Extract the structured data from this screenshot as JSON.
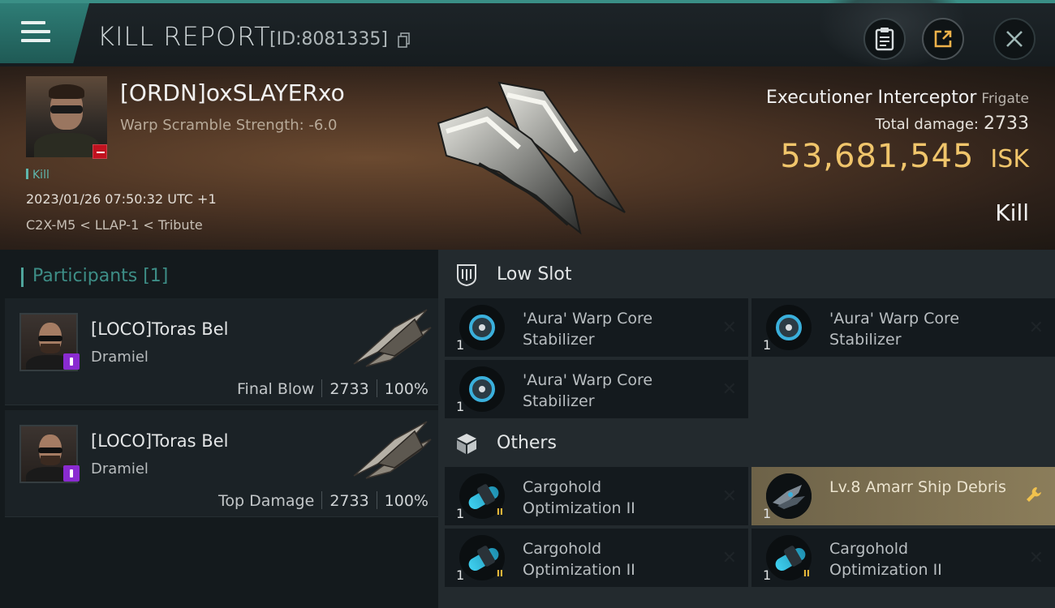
{
  "header": {
    "title": "KILL REPORT",
    "report_id": "[ID:8081335]"
  },
  "victim": {
    "name": "[ORDN]oxSLAYERxo",
    "warp_scramble": "Warp Scramble Strength: -6.0",
    "tag": "Kill",
    "datetime": "2023/01/26 07:50:32 UTC +1",
    "location": "C2X-M5 < LLAP-1 < Tribute",
    "ship_name": "Executioner Interceptor",
    "ship_class": "Frigate",
    "total_damage_label": "Total damage:",
    "total_damage": "2733",
    "isk_value": "53,681,545",
    "isk_unit": "ISK",
    "result": "Kill"
  },
  "participants": {
    "header": "Participants [1]",
    "items": [
      {
        "name": "[LOCO]Toras Bel",
        "ship": "Dramiel",
        "role": "Final Blow",
        "damage": "2733",
        "percent": "100%"
      },
      {
        "name": "[LOCO]Toras Bel",
        "ship": "Dramiel",
        "role": "Top Damage",
        "damage": "2733",
        "percent": "100%"
      }
    ]
  },
  "low_slot": {
    "header": "Low Slot",
    "items": [
      {
        "qty": "1",
        "name": "'Aura' Warp Core Stabilizer",
        "icon": "warp-core-stabilizer-icon"
      },
      {
        "qty": "1",
        "name": "'Aura' Warp Core Stabilizer",
        "icon": "warp-core-stabilizer-icon"
      },
      {
        "qty": "1",
        "name": "'Aura' Warp Core Stabilizer",
        "icon": "warp-core-stabilizer-icon"
      }
    ]
  },
  "others": {
    "header": "Others",
    "items": [
      {
        "qty": "1",
        "name": "Cargohold Optimization II",
        "icon": "cargohold-optimization-icon",
        "tier": "II"
      },
      {
        "qty": "1",
        "name": "Lv.8 Amarr Ship Debris",
        "icon": "ship-debris-icon",
        "highlight": true
      },
      {
        "qty": "1",
        "name": "Cargohold Optimization II",
        "icon": "cargohold-optimization-icon",
        "tier": "II"
      },
      {
        "qty": "1",
        "name": "Cargohold Optimization II",
        "icon": "cargohold-optimization-icon",
        "tier": "II"
      }
    ]
  },
  "colors": {
    "accent": "#3a8f86",
    "isk": "#f0c56b",
    "highlight_slot": "#8b7d5a",
    "badge_purple": "#8a2bd1",
    "badge_red": "#c1121f"
  }
}
